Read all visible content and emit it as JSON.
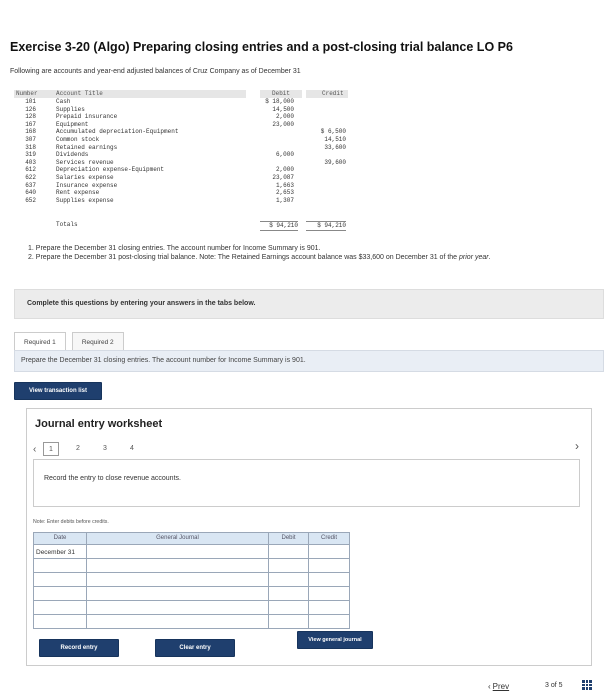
{
  "title": "Exercise 3-20 (Algo) Preparing closing entries and a post-closing trial balance LO P6",
  "intro": "Following are accounts and year-end adjusted balances of Cruz Company as of December 31",
  "accounts_table": {
    "headers": {
      "number": "Number",
      "title": "Account Title",
      "debit": "Debit",
      "credit": "Credit"
    },
    "rows": [
      {
        "number": "101",
        "title": "Cash",
        "debit": "$ 18,000",
        "credit": ""
      },
      {
        "number": "126",
        "title": "Supplies",
        "debit": "14,500",
        "credit": ""
      },
      {
        "number": "128",
        "title": "Prepaid insurance",
        "debit": "2,000",
        "credit": ""
      },
      {
        "number": "167",
        "title": "Equipment",
        "debit": "23,000",
        "credit": ""
      },
      {
        "number": "168",
        "title": "Accumulated depreciation-Equipment",
        "debit": "",
        "credit": "$ 6,500"
      },
      {
        "number": "307",
        "title": "Common stock",
        "debit": "",
        "credit": "14,510"
      },
      {
        "number": "318",
        "title": "Retained earnings",
        "debit": "",
        "credit": "33,600"
      },
      {
        "number": "319",
        "title": "Dividends",
        "debit": "6,000",
        "credit": ""
      },
      {
        "number": "403",
        "title": "Services revenue",
        "debit": "",
        "credit": "39,600"
      },
      {
        "number": "612",
        "title": "Depreciation expense-Equipment",
        "debit": "2,000",
        "credit": ""
      },
      {
        "number": "622",
        "title": "Salaries expense",
        "debit": "23,087",
        "credit": ""
      },
      {
        "number": "637",
        "title": "Insurance expense",
        "debit": "1,663",
        "credit": ""
      },
      {
        "number": "640",
        "title": "Rent expense",
        "debit": "2,653",
        "credit": ""
      },
      {
        "number": "652",
        "title": "Supplies expense",
        "debit": "1,307",
        "credit": ""
      }
    ],
    "totals": {
      "label": "Totals",
      "debit": "$ 94,210",
      "credit": "$ 94,210"
    }
  },
  "instructions": {
    "item1": "1. Prepare the December 31 closing entries. The account number for Income Summary is 901.",
    "item2_pre": "2. Prepare the December 31 post-closing trial balance. Note: The Retained Earnings account balance was $33,600 on December 31 of the ",
    "item2_italic": "prior year",
    "item2_post": "."
  },
  "banner": "Complete this questions by entering your answers in the tabs below.",
  "tabs": [
    {
      "label": "Required 1"
    },
    {
      "label": "Required 2"
    }
  ],
  "panel_text": "Prepare the December 31 closing entries. The account number for Income Summary is 901.",
  "view_transaction_label": "View transaction list",
  "worksheet": {
    "title": "Journal entry worksheet",
    "pages": [
      "1",
      "2",
      "3",
      "4"
    ],
    "record_text": "Record the entry to close revenue accounts.",
    "note": "Note: Enter debits before credits.",
    "headers": {
      "date": "Date",
      "account": "General Journal",
      "debit": "Debit",
      "credit": "Credit"
    },
    "date_value": "December 31",
    "record_entry_label": "Record entry",
    "clear_entry_label": "Clear entry",
    "view_general_journal_label": "View general journal"
  },
  "footer": {
    "prev_label": "Prev",
    "page_of": "3 of 5"
  },
  "colors": {
    "button": "#1f3f6e",
    "grid_header": "#d9e6f3",
    "banner": "#ececec"
  }
}
